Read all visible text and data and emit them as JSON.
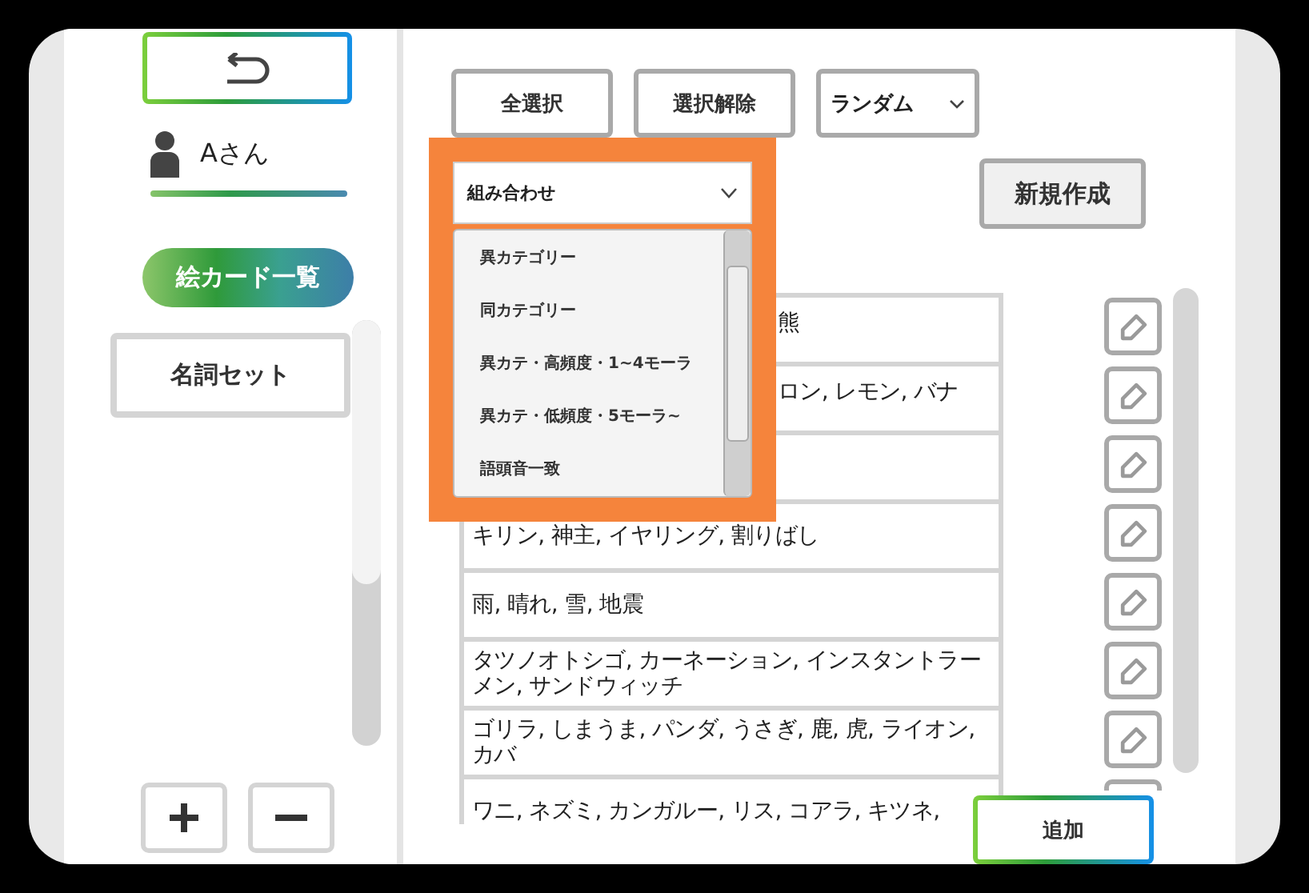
{
  "user": {
    "name": "Aさん"
  },
  "nav_pill": {
    "label": "絵カード一覧"
  },
  "sets": [
    {
      "label": "名詞セット"
    }
  ],
  "toolbar": {
    "buttons": [
      "全選択",
      "選択解除"
    ],
    "order_select": {
      "value": "ランダム"
    }
  },
  "combo_select": {
    "value": "組み合わせ",
    "expanded": true,
    "options": [
      "異カテゴリー",
      "同カテゴリー",
      "異カテ・高頻度・1~4モーラ",
      "異カテ・低頻度・5モーラ~",
      "語頭音一致"
    ]
  },
  "new_button": {
    "label": "新規作成"
  },
  "rows": [
    {
      "kind": "partial",
      "text": "熊"
    },
    {
      "kind": "partial",
      "text": "ロン, レモン, バナ"
    },
    {
      "kind": "covered"
    },
    {
      "kind": "full",
      "text": "キリン, 神主, イヤリング, 割りばし"
    },
    {
      "kind": "full",
      "text": "雨, 晴れ, 雪, 地震"
    },
    {
      "kind": "full",
      "text": "タツノオトシゴ, カーネーション, インスタントラーメン, サンドウィッチ"
    },
    {
      "kind": "full",
      "text": "ゴリラ, しまうま, パンダ, うさぎ, 鹿, 虎, ライオン, カバ"
    },
    {
      "kind": "full",
      "text": "ワニ, ネズミ, カンガルー, リス, コアラ, キツネ,"
    }
  ],
  "add_button": {
    "label": "追加"
  }
}
